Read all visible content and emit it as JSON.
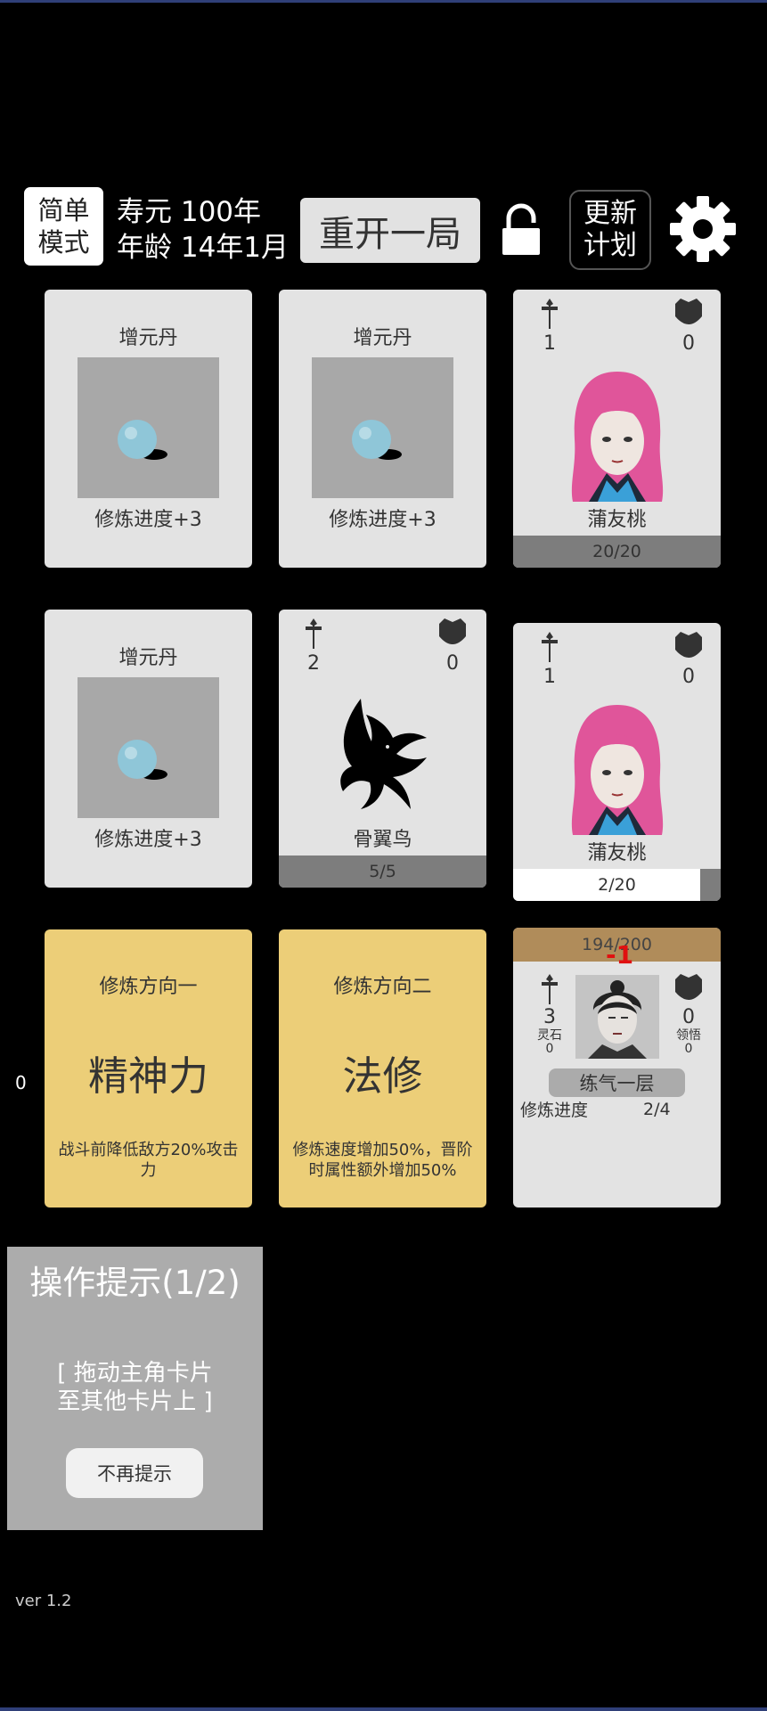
{
  "header": {
    "mode_line1": "简单",
    "mode_line2": "模式",
    "lifespan": "寿元 100年",
    "age": "年龄 14年1月",
    "restart_label": "重开一局",
    "plan_line1": "更新",
    "plan_line2": "计划"
  },
  "cards": {
    "item1": {
      "title": "增元丹",
      "desc": "修炼进度+3"
    },
    "item2": {
      "title": "增元丹",
      "desc": "修炼进度+3"
    },
    "item3": {
      "title": "增元丹",
      "desc": "修炼进度+3"
    },
    "char1": {
      "attack": "1",
      "defense": "0",
      "name": "蒲友桃",
      "hp": "20/20"
    },
    "bird": {
      "attack": "2",
      "defense": "0",
      "name": "骨翼鸟",
      "hp": "5/5"
    },
    "char2": {
      "attack": "1",
      "defense": "0",
      "name": "蒲友桃",
      "hp": "2/20",
      "hp_fraction": 0.9
    },
    "dir1": {
      "title": "修炼方向一",
      "name": "精神力",
      "desc": "战斗前降低敌方20%攻击力"
    },
    "dir2": {
      "title": "修炼方向二",
      "name": "法修",
      "desc": "修炼速度增加50%，晋阶时属性额外增加50%"
    },
    "hero": {
      "hp": "194/200",
      "damage": "-1",
      "attack": "3",
      "defense": "0",
      "stone_label": "灵石",
      "stone_value": "0",
      "insight_label": "领悟",
      "insight_value": "0",
      "realm": "练气一层",
      "progress_label": "修炼进度",
      "progress_value": "2/4"
    }
  },
  "side_counter": "0",
  "tip": {
    "title": "操作提示(1/2)",
    "line1": "[ 拖动主角卡片",
    "line2": "至其他卡片上 ]",
    "button": "不再提示"
  },
  "version": "ver 1.2"
}
